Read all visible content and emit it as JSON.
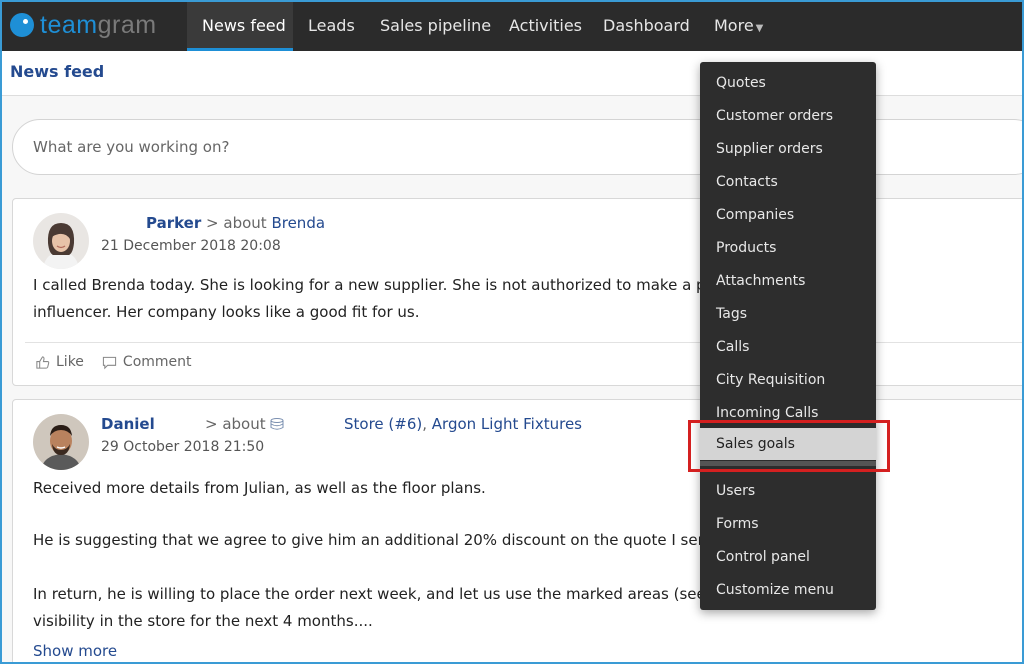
{
  "app": {
    "logo_team": "team",
    "logo_gram": "gram",
    "brand_color": "#1e8fd6"
  },
  "nav": {
    "items": [
      {
        "label": "News feed",
        "active": true
      },
      {
        "label": "Leads"
      },
      {
        "label": "Sales pipeline"
      },
      {
        "label": "Activities"
      },
      {
        "label": "Dashboard"
      },
      {
        "label": "More"
      }
    ]
  },
  "page": {
    "title": "News feed",
    "composer_placeholder": "What are you working on?"
  },
  "posts": [
    {
      "author": "Parker",
      "about_prefix": "> about",
      "about": "Brenda",
      "date": "21 December 2018 20:08",
      "body": [
        "I called Brenda today. She is looking for a new supplier. She is not authorized to make a purchase",
        "influencer. Her company looks like a good fit for us."
      ],
      "like_label": "Like",
      "comment_label": "Comment"
    },
    {
      "author": "Daniel",
      "about_prefix": "> about",
      "about_store": "Store (#6)",
      "about_sep": ",",
      "about_company": "Argon Light Fixtures",
      "date": "29 October 2018 21:50",
      "body": [
        "Received more details from Julian, as well as the floor plans.",
        "He is suggesting that we agree to give him an additional 20% discount on the quote I sent him ea",
        "In return, he is willing to place the order next week, and let us use the marked areas (see attache",
        "visibility in the store for the next 4 months...."
      ],
      "show_more": "Show more"
    }
  ],
  "more_menu": {
    "items": [
      "Quotes",
      "Customer orders",
      "Supplier orders",
      "Contacts",
      "Companies",
      "Products",
      "Attachments",
      "Tags",
      "Calls",
      "City Requisition",
      "Incoming Calls",
      "Sales goals",
      "Users",
      "Forms",
      "Control panel",
      "Customize menu"
    ],
    "highlighted": "Sales goals",
    "highlight_outline_color": "#d42020"
  }
}
